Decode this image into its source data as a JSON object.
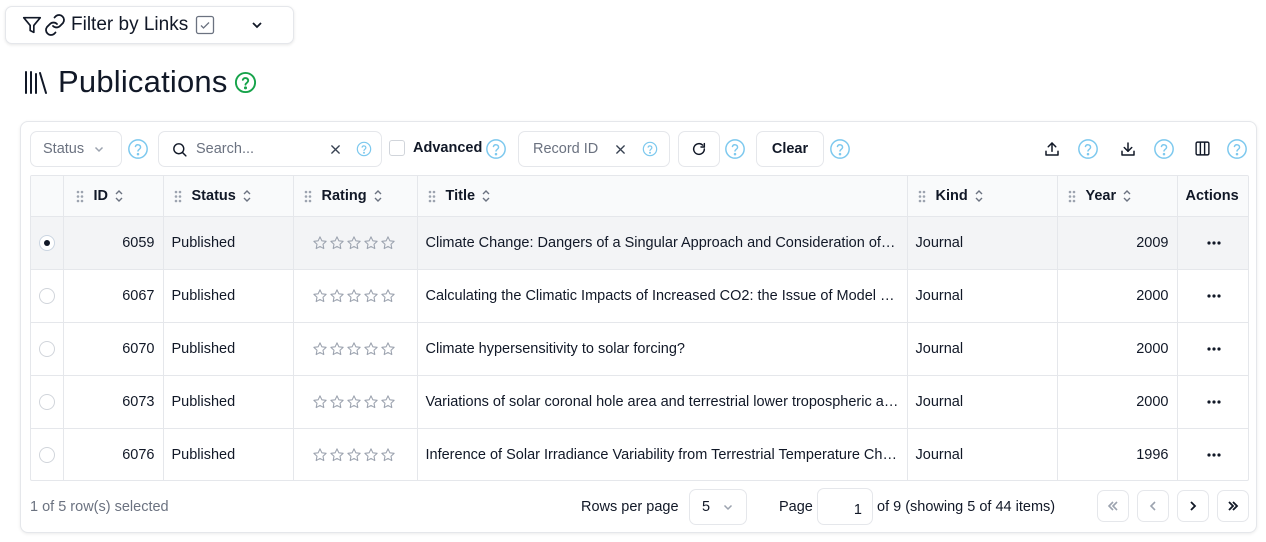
{
  "filter": {
    "label": "Filter by Links"
  },
  "page": {
    "title": "Publications"
  },
  "toolbar": {
    "status_placeholder": "Status",
    "search_placeholder": "Search...",
    "advanced_label": "Advanced",
    "record_id_placeholder": "Record ID",
    "clear_label": "Clear"
  },
  "table": {
    "headers": {
      "id": "ID",
      "status": "Status",
      "rating": "Rating",
      "title": "Title",
      "kind": "Kind",
      "year": "Year",
      "actions": "Actions"
    },
    "rows": [
      {
        "id": "6059",
        "status": "Published",
        "title": "Climate Change: Dangers of a Singular Approach and Consideration of Multiple Factors",
        "kind": "Journal",
        "year": "2009",
        "selected": true
      },
      {
        "id": "6067",
        "status": "Published",
        "title": "Calculating the Climatic Impacts of Increased CO2: the Issue of Model Validation",
        "kind": "Journal",
        "year": "2000",
        "selected": false
      },
      {
        "id": "6070",
        "status": "Published",
        "title": "Climate hypersensitivity to solar forcing?",
        "kind": "Journal",
        "year": "2000",
        "selected": false
      },
      {
        "id": "6073",
        "status": "Published",
        "title": "Variations of solar coronal hole area and terrestrial lower tropospheric air temperature",
        "kind": "Journal",
        "year": "2000",
        "selected": false
      },
      {
        "id": "6076",
        "status": "Published",
        "title": "Inference of Solar Irradiance Variability from Terrestrial Temperature Changes",
        "kind": "Journal",
        "year": "1996",
        "selected": false
      }
    ]
  },
  "footer": {
    "selected_text": "1 of 5 row(s) selected",
    "rows_per_page_label": "Rows per page",
    "rows_per_page_value": "5",
    "page_label": "Page",
    "page_value": "1",
    "page_info": "of 9 (showing 5 of 44 items)"
  },
  "colors": {
    "help_blue": "#7cc8ee",
    "help_green": "#16a34a",
    "border": "#e5e7eb",
    "star_gray": "#9ca3af"
  },
  "icons": [
    "filter-icon",
    "link-icon",
    "checkbox-icon",
    "chevron-down-icon",
    "library-icon",
    "help-icon",
    "search-icon",
    "close-icon",
    "refresh-icon",
    "upload-icon",
    "download-icon",
    "columns-icon",
    "grip-icon",
    "sort-icon",
    "star-icon",
    "more-icon",
    "chevrons-left-icon",
    "chevron-left-icon",
    "chevron-right-icon",
    "chevrons-right-icon"
  ]
}
